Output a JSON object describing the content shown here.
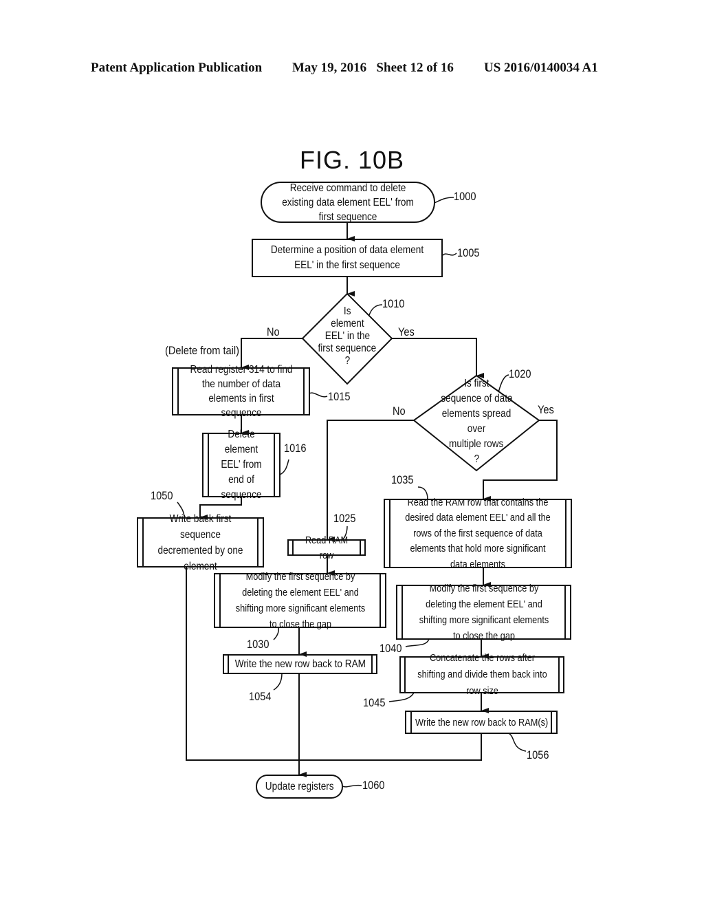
{
  "header": {
    "left": "Patent Application Publication",
    "date_sheet": "May 19, 2016   Sheet 12 of 16",
    "number": "US 2016/0140034 A1"
  },
  "figure": {
    "title": "FIG. 10B",
    "nodes": {
      "n1000": {
        "ref": "1000",
        "shape": "terminal",
        "text": "Receive command to delete existing data element EEL' from first sequence"
      },
      "n1005": {
        "ref": "1005",
        "shape": "process",
        "text": "Determine a position of data element EEL' in the first sequence"
      },
      "n1010": {
        "ref": "1010",
        "shape": "decision",
        "lines": [
          "Is",
          "element",
          "EEL' in the",
          "first sequence",
          "?"
        ]
      },
      "n1015": {
        "ref": "1015",
        "shape": "predefined",
        "text": "Read register 314 to find the number of data elements in first sequence"
      },
      "n1016": {
        "ref": "1016",
        "shape": "predefined",
        "text": "Delete element EEL' from end of sequence"
      },
      "n1050": {
        "ref": "1050",
        "shape": "predefined",
        "text": "Write back first sequence decremented by one element"
      },
      "n1020": {
        "ref": "1020",
        "shape": "decision",
        "lines": [
          "Is first",
          "sequence of data",
          "elements spread over",
          "multiple rows",
          "?"
        ]
      },
      "n1025": {
        "ref": "1025",
        "shape": "predefined",
        "text": "Read RAM row"
      },
      "n1030": {
        "ref": "1030",
        "shape": "predefined",
        "text": "Modify the first sequence by deleting the element EEL' and shifting more significant elements to close the gap"
      },
      "n1054": {
        "ref": "1054",
        "shape": "predefined",
        "text": "Write the new row back to RAM"
      },
      "n1035": {
        "ref": "1035",
        "shape": "predefined",
        "text": "Read the RAM row that contains the desired data element EEL' and all the rows of the first sequence of data elements that hold more significant data elements"
      },
      "n1040": {
        "ref": "1040",
        "shape": "predefined",
        "text": "Modify the first sequence by deleting the element EEL' and shifting more significant elements to close the gap"
      },
      "n1045": {
        "ref": "1045",
        "shape": "predefined",
        "text": "Concatenate the rows after shifting and divide them back into row size"
      },
      "n1056": {
        "ref": "1056",
        "shape": "predefined",
        "text": "Write the new row back to RAM(s)"
      },
      "n1060": {
        "ref": "1060",
        "shape": "terminal",
        "text": "Update registers"
      }
    },
    "edge_labels": {
      "d1010_no": "No",
      "d1010_yes": "Yes",
      "d1010_no_note": "(Delete from tail)",
      "d1020_no": "No",
      "d1020_yes": "Yes"
    }
  }
}
